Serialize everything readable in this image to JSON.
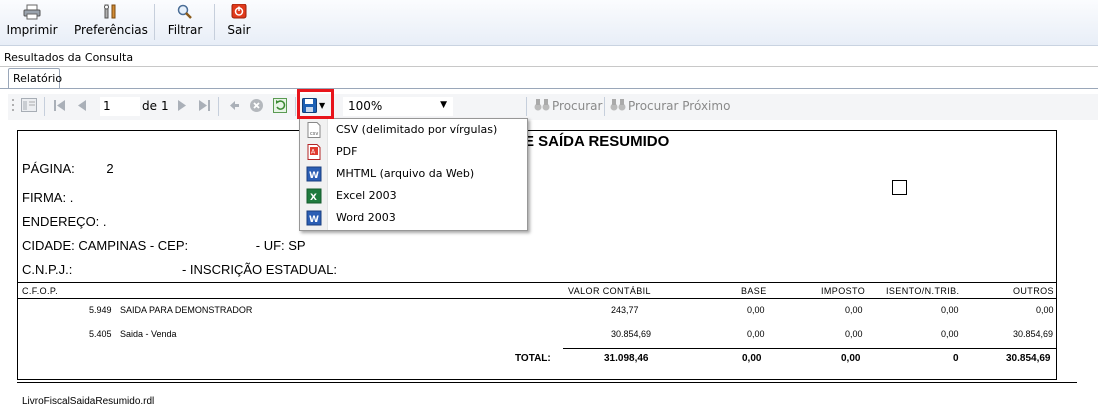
{
  "toolbar": {
    "print_label": "Imprimir",
    "prefs_label": "Preferências",
    "filter_label": "Filtrar",
    "exit_label": "Sair"
  },
  "results_label": "Resultados da Consulta",
  "tab_label": "Relatório",
  "viewer": {
    "page_current": "1",
    "page_of_label": "de",
    "page_total": "1",
    "zoom": "100%",
    "find_label": "Procurar",
    "find_next_label": "Procurar Próximo"
  },
  "export_menu": [
    {
      "label": "CSV (delimitado por vírgulas)",
      "icon": "csv-file-icon"
    },
    {
      "label": "PDF",
      "icon": "pdf-file-icon"
    },
    {
      "label": "MHTML (arquivo da Web)",
      "icon": "word-file-icon"
    },
    {
      "label": "Excel 2003",
      "icon": "excel-file-icon"
    },
    {
      "label": "Word 2003",
      "icon": "word-file-icon"
    }
  ],
  "report": {
    "title": "E SAÍDA RESUMIDO",
    "page_label": "PÁGINA:",
    "page_value": "2",
    "firma_label": "FIRMA:",
    "firma_value": ".",
    "endereco_label": "ENDEREÇO:",
    "endereco_value": ".",
    "cidade_text": "CIDADE: CAMPINAS - CEP:",
    "uf_text": "- UF: SP",
    "cnpj_label": "C.N.P.J.:",
    "ie_label": "- INSCRIÇÃO  ESTADUAL:",
    "columns": [
      "C.F.O.P.",
      "VALOR CONTÁBIL",
      "BASE",
      "IMPOSTO",
      "ISENTO/N.TRIB.",
      "OUTROS"
    ],
    "rows": [
      {
        "cfop": "5.949",
        "desc": "SAIDA PARA DEMONSTRADOR",
        "valor": "243,77",
        "base": "0,00",
        "imposto": "0,00",
        "isento": "0,00",
        "outros": "0,00"
      },
      {
        "cfop": "5.405",
        "desc": "Saida - Venda",
        "valor": "30.854,69",
        "base": "0,00",
        "imposto": "0,00",
        "isento": "0,00",
        "outros": "30.854,69"
      }
    ],
    "total": {
      "label": "TOTAL:",
      "valor": "31.098,46",
      "base": "0,00",
      "imposto": "0,00",
      "isento": "0",
      "outros": "30.854,69"
    },
    "footer": "LivroFiscalSaidaResumido.rdl"
  },
  "colors": {
    "highlight_border": "#e8141b",
    "toolbar_bg": "#e8eef7",
    "save_icon": "#1c5fb4"
  }
}
